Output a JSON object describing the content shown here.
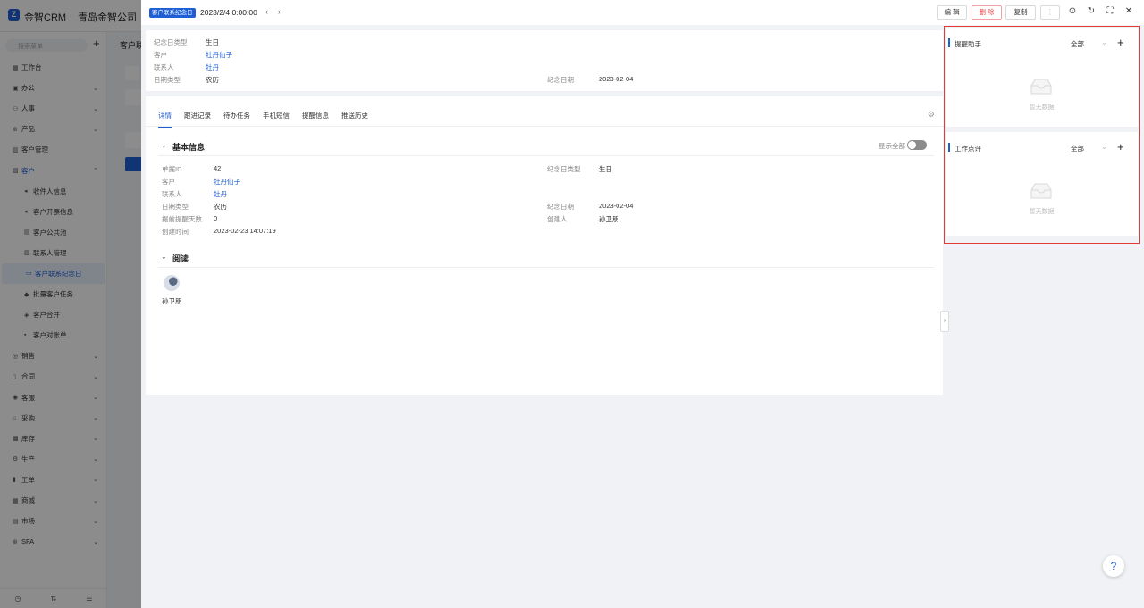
{
  "app": {
    "brand": "金智CRM",
    "company": "青岛金智公司",
    "search_placeholder": "搜索菜单",
    "content_title": "客户联"
  },
  "sidebar": {
    "items": [
      {
        "label": "工作台",
        "icon": "dashboard-icon",
        "arrow": ""
      },
      {
        "label": "办公",
        "icon": "office-icon",
        "arrow": "⌄"
      },
      {
        "label": "人事",
        "icon": "people-icon",
        "arrow": "⌄"
      },
      {
        "label": "产品",
        "icon": "product-icon",
        "arrow": "⌄"
      },
      {
        "label": "客户管理",
        "icon": "customer-manage-icon",
        "arrow": ""
      },
      {
        "label": "客户",
        "icon": "customer-icon",
        "arrow": "⌃"
      },
      {
        "label": "收件人信息",
        "icon": "sound-icon",
        "arrow": ""
      },
      {
        "label": "客户开票信息",
        "icon": "sound-icon",
        "arrow": ""
      },
      {
        "label": "客户公共池",
        "icon": "pool-icon",
        "arrow": ""
      },
      {
        "label": "联系人管理",
        "icon": "contact-icon",
        "arrow": ""
      },
      {
        "label": "客户联系纪念日",
        "icon": "calendar-icon",
        "arrow": ""
      },
      {
        "label": "批量客户任务",
        "icon": "task-icon",
        "arrow": ""
      },
      {
        "label": "客户合并",
        "icon": "merge-icon",
        "arrow": ""
      },
      {
        "label": "客户对账单",
        "icon": "bill-icon",
        "arrow": ""
      },
      {
        "label": "销售",
        "icon": "sales-icon",
        "arrow": "⌄"
      },
      {
        "label": "合同",
        "icon": "contract-icon",
        "arrow": "⌄"
      },
      {
        "label": "客服",
        "icon": "service-icon",
        "arrow": "⌄"
      },
      {
        "label": "采购",
        "icon": "purchase-icon",
        "arrow": "⌄"
      },
      {
        "label": "库存",
        "icon": "stock-icon",
        "arrow": "⌄"
      },
      {
        "label": "生产",
        "icon": "production-icon",
        "arrow": "⌄"
      },
      {
        "label": "工单",
        "icon": "workorder-icon",
        "arrow": "⌄"
      },
      {
        "label": "商城",
        "icon": "mall-icon",
        "arrow": "⌄"
      },
      {
        "label": "市场",
        "icon": "market-icon",
        "arrow": "⌄"
      },
      {
        "label": "SFA",
        "icon": "sfa-icon",
        "arrow": "⌄"
      }
    ]
  },
  "drawer": {
    "tag": "客户联系纪念日",
    "date": "2023/2/4 0:00:00",
    "buttons": {
      "edit": "编 辑",
      "delete": "删 除",
      "copy": "复制",
      "more": "⋮"
    },
    "summary": {
      "type_label": "纪念日类型",
      "type_value": "生日",
      "customer_label": "客户",
      "customer_value": "牡丹仙子",
      "contact_label": "联系人",
      "contact_value": "牡丹",
      "datetype_label": "日期类型",
      "datetype_value": "农历",
      "date_label": "纪念日期",
      "date_value": "2023-02-04"
    },
    "tabs": [
      "详情",
      "跟进记录",
      "待办任务",
      "手机短信",
      "提醒信息",
      "推送历史"
    ],
    "basic": {
      "title": "基本信息",
      "show_all": "显示全部",
      "id_label": "单据ID",
      "id_value": "42",
      "customer_label": "客户",
      "customer_value": "牡丹仙子",
      "contact_label": "联系人",
      "contact_value": "牡丹",
      "datetype_label": "日期类型",
      "datetype_value": "农历",
      "advance_label": "提前提醒天数",
      "advance_value": "0",
      "created_label": "创建时间",
      "created_value": "2023-02-23 14:07:19",
      "type_label": "纪念日类型",
      "type_value": "生日",
      "date_label": "纪念日期",
      "date_value": "2023-02-04",
      "creator_label": "创建人",
      "creator_value": "孙卫朋"
    },
    "read": {
      "title": "阅读",
      "reader": "孙卫朋"
    }
  },
  "right_panel": {
    "reminder": {
      "title": "提醒助手",
      "filter": "全部",
      "empty": "暂无数据"
    },
    "review": {
      "title": "工作点评",
      "filter": "全部",
      "empty": "暂无数据"
    }
  },
  "colors": {
    "accent": "#1f5fd6",
    "danger": "#e3393c",
    "highlight_border": "#e53935"
  }
}
